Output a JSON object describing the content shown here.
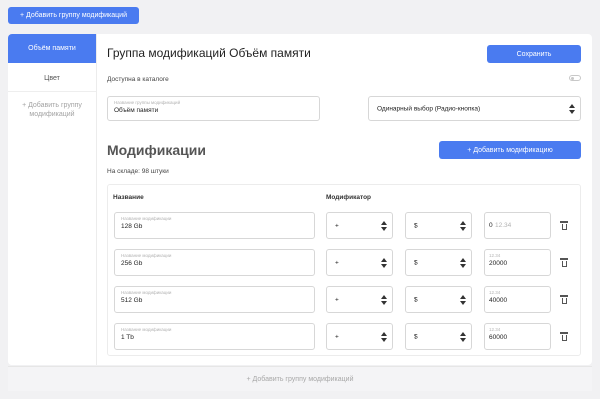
{
  "top": {
    "add_group_label": "+ Добавить группу модификаций"
  },
  "sidebar": {
    "items": [
      {
        "label": "Объём памяти"
      },
      {
        "label": "Цвет"
      }
    ],
    "add_group_label": "+ Добавить группу модификаций"
  },
  "group": {
    "title": "Группа модификаций Объём памяти",
    "save_label": "Сохранить",
    "catalog_label": "Доступна в каталоге",
    "catalog_enabled": false,
    "name_field": {
      "placeholder": "Название группы модификаций",
      "value": "Объём памяти"
    },
    "selection_type": "Одинарный выбор (Радио-кнопка)"
  },
  "modifications": {
    "title": "Модификации",
    "add_label": "+ Добавить модификацию",
    "stock_label": "На складе: 98 штуки",
    "headers": {
      "name": "Название",
      "modifier": "Модификатор"
    },
    "rows": [
      {
        "name_placeholder": "Название модификации",
        "name": "128 Gb",
        "op": "+",
        "currency": "$",
        "price_placeholder": "12.34",
        "price": "0"
      },
      {
        "name_placeholder": "Название модификации",
        "name": "256 Gb",
        "op": "+",
        "currency": "$",
        "price_placeholder": "12.34",
        "price": "20000"
      },
      {
        "name_placeholder": "Название модификации",
        "name": "512 Gb",
        "op": "+",
        "currency": "$",
        "price_placeholder": "12.34",
        "price": "40000"
      },
      {
        "name_placeholder": "Название модификации",
        "name": "1 Tb",
        "op": "+",
        "currency": "$",
        "price_placeholder": "12.34",
        "price": "60000"
      }
    ]
  },
  "footer": {
    "add_group_label": "+ Добавить группу модификаций"
  },
  "colors": {
    "accent": "#4a7bf0",
    "background": "#f1f1f3"
  },
  "icons": {
    "delete": "trash-icon",
    "select": "select-arrows-icon"
  }
}
